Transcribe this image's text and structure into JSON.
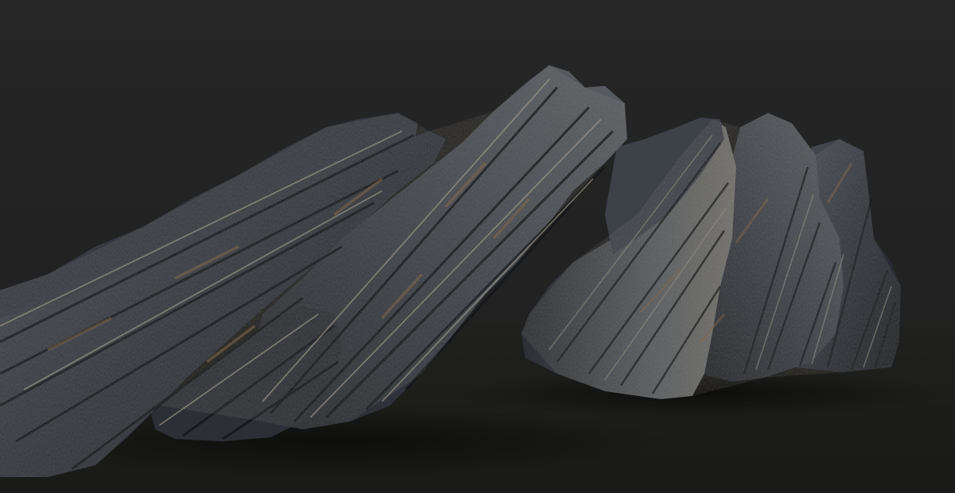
{
  "scene": {
    "subject": "layered-rock-formation",
    "colors": {
      "background": "#232323",
      "floor": "#1c1c1a",
      "rock_dark": "#22252b",
      "rock_mid": "#3e434b",
      "rock_light": "#6b6f74",
      "rock_highlight": "#9a958a",
      "rust": "#7a6046"
    }
  }
}
